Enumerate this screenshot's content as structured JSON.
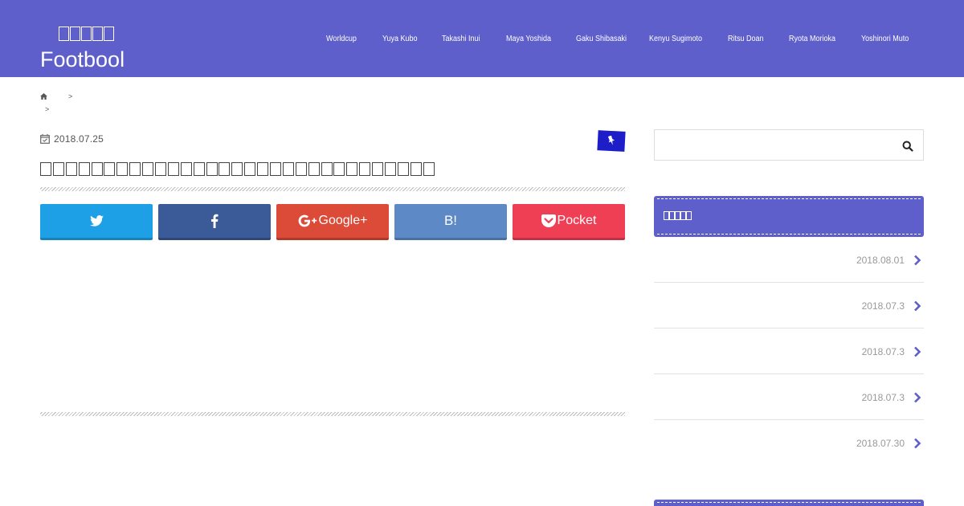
{
  "site": {
    "logo_jp": "?????",
    "logo_en": "Footbool"
  },
  "nav": {
    "items": [
      {
        "label": "Worldcup"
      },
      {
        "label": "Yuya Kubo"
      },
      {
        "label": "Takashi Inui"
      },
      {
        "label": "Maya Yoshida"
      },
      {
        "label": "Gaku Shibasaki"
      },
      {
        "label": "Kenyu Sugimoto"
      },
      {
        "label": "Ritsu Doan"
      },
      {
        "label": "Ryota Morioka"
      },
      {
        "label": "Yoshinori Muto"
      }
    ]
  },
  "breadcrumb": {
    "home_icon": "home-icon",
    "separator": ">"
  },
  "article": {
    "date": "2018.07.25",
    "title_placeholder_count": 31,
    "category_icon": "pin-icon",
    "category_color": "#1e1ec8"
  },
  "share": {
    "twitter_icon": "twitter-icon",
    "facebook_icon": "facebook-icon",
    "googleplus_label": "Google+",
    "hatena_label": "B!",
    "pocket_label": "Pocket"
  },
  "sidebar": {
    "search_icon": "search-icon",
    "widget_title": "?????",
    "posts": [
      {
        "date": "2018.08.01"
      },
      {
        "date": "2018.07.3"
      },
      {
        "date": "2018.07.3"
      },
      {
        "date": "2018.07.3"
      },
      {
        "date": "2018.07.30"
      }
    ]
  },
  "colors": {
    "header_bg": "#5f5fcc",
    "twitter": "#1da0e6",
    "facebook": "#3b5a98",
    "googleplus": "#dc4a38",
    "hatena": "#5d8ac6",
    "pocket": "#ee3f55"
  }
}
